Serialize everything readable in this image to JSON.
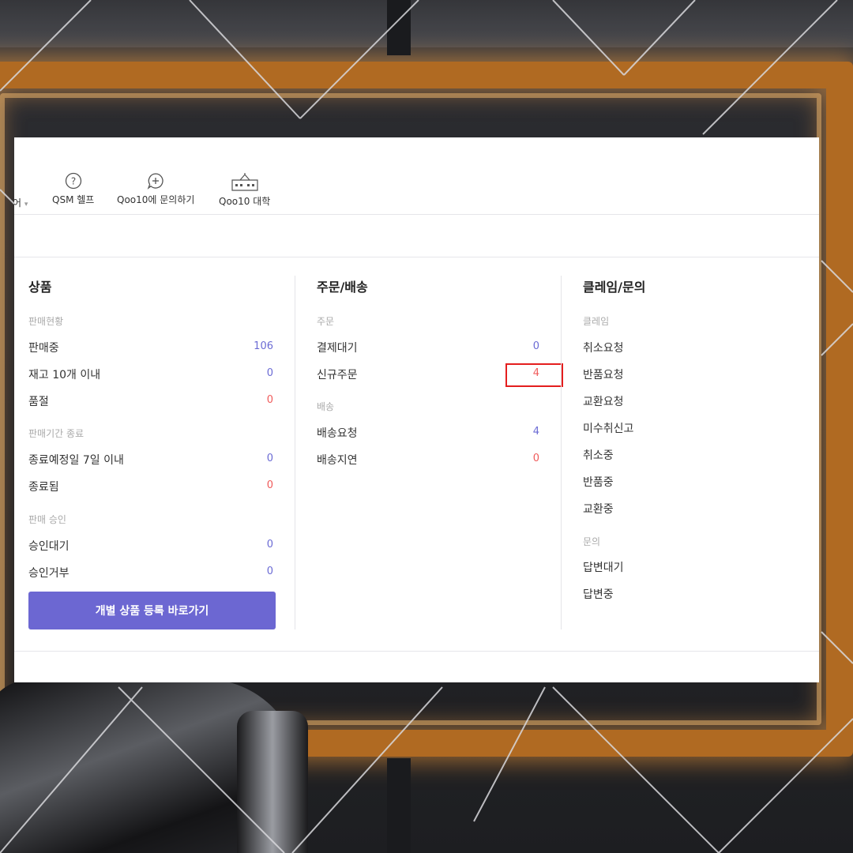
{
  "toolbar": {
    "cut_label": "어",
    "items": [
      {
        "label": "QSM 헬프",
        "icon": "question-circle-icon"
      },
      {
        "label": "Qoo10에 문의하기",
        "icon": "chat-plus-icon"
      },
      {
        "label": "Qoo10 대학",
        "icon": "school-building-icon"
      }
    ]
  },
  "products": {
    "title": "상품",
    "sales_status": {
      "heading": "판매현황",
      "rows": [
        {
          "label": "판매중",
          "value": "106"
        },
        {
          "label": "재고 10개 이내",
          "value": "0"
        },
        {
          "label": "품절",
          "value": "0"
        }
      ]
    },
    "sales_period_end": {
      "heading": "판매기간 종료",
      "rows": [
        {
          "label": "종료예정일 7일 이내",
          "value": "0"
        },
        {
          "label": "종료됨",
          "value": "0"
        }
      ]
    },
    "sales_approval": {
      "heading": "판매 승인",
      "rows": [
        {
          "label": "승인대기",
          "value": "0"
        },
        {
          "label": "승인거부",
          "value": "0"
        }
      ]
    },
    "cta_label": "개별 상품 등록 바로가기"
  },
  "orders": {
    "title": "주문/배송",
    "order": {
      "heading": "주문",
      "rows": [
        {
          "label": "결제대기",
          "value": "0"
        },
        {
          "label": "신규주문",
          "value": "4"
        }
      ]
    },
    "shipping": {
      "heading": "배송",
      "rows": [
        {
          "label": "배송요청",
          "value": "4"
        },
        {
          "label": "배송지연",
          "value": "0"
        }
      ]
    }
  },
  "claims": {
    "title": "클레임/문의",
    "claim": {
      "heading": "클레임",
      "rows": [
        {
          "label": "취소요청"
        },
        {
          "label": "반품요청"
        },
        {
          "label": "교환요청"
        },
        {
          "label": "미수취신고"
        },
        {
          "label": "취소중"
        },
        {
          "label": "반품중"
        },
        {
          "label": "교환중"
        }
      ]
    },
    "inquiry": {
      "heading": "문의",
      "rows": [
        {
          "label": "답변대기"
        },
        {
          "label": "답변중"
        }
      ]
    }
  },
  "colors": {
    "accent": "#6c67d2",
    "count_blue": "#6b6bd4",
    "count_red": "#f05b5b",
    "highlight_box": "#e41e1e"
  }
}
